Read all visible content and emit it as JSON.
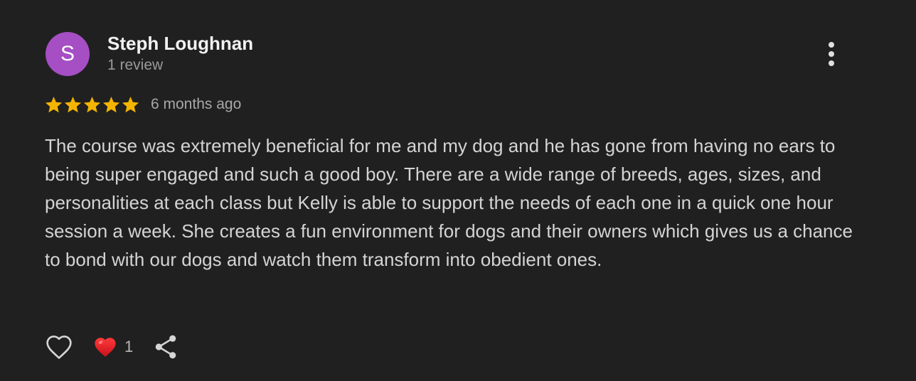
{
  "review": {
    "author": {
      "initial": "S",
      "name": "Steph Loughnan",
      "review_count": "1 review",
      "avatar_color": "#a64ec4"
    },
    "rating": 5,
    "max_rating": 5,
    "star_color": "#f4b400",
    "time_ago": "6 months ago",
    "text": "The course was extremely beneficial for me and my dog and he has gone from having no ears to being super engaged and such a good boy. There are a wide range of breeds, ages, sizes, and personalities at each class but Kelly is able to support the needs of each one in a quick one hour session a week. She creates a fun environment for dogs and their owners which gives us a chance to bond with our dogs and watch them transform into obedient ones.",
    "reactions": {
      "like_icon": "heart-outline-icon",
      "reaction_icon": "red-heart-icon",
      "reaction_count": "1",
      "share_icon": "share-icon"
    },
    "menu_icon": "more-vertical-icon"
  }
}
